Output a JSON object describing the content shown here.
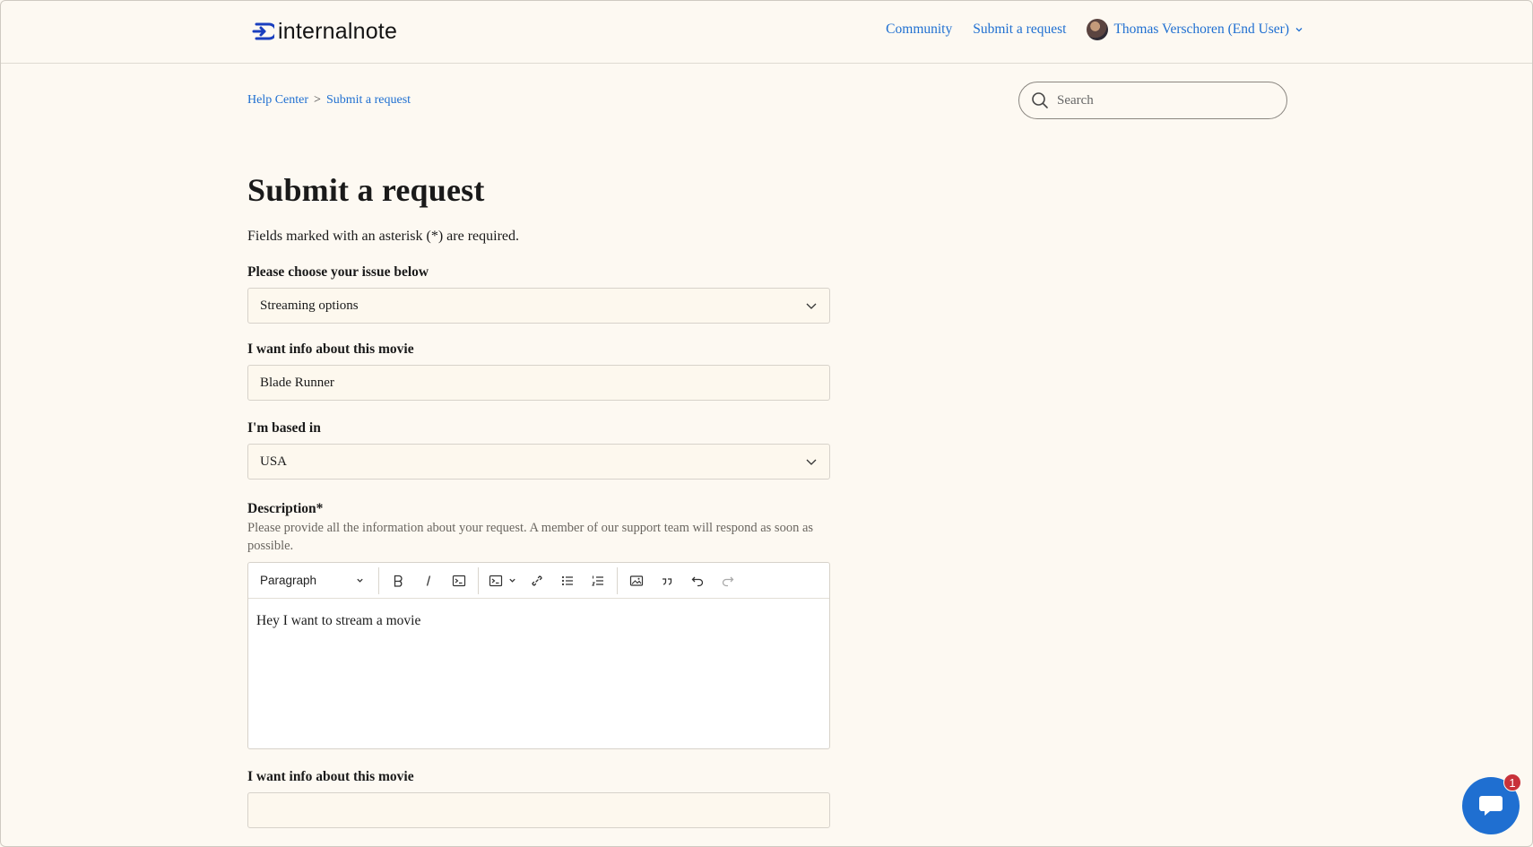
{
  "header": {
    "logo_text": "internalnote",
    "nav": {
      "community": "Community",
      "submit_request": "Submit a request",
      "user_name": "Thomas Verschoren (End User)"
    }
  },
  "breadcrumb": {
    "home": "Help Center",
    "separator": ">",
    "current": "Submit a request"
  },
  "search": {
    "placeholder": "Search"
  },
  "page": {
    "title": "Submit a request",
    "required_note": "Fields marked with an asterisk (*) are required."
  },
  "form": {
    "issue": {
      "label": "Please choose your issue below",
      "value": "Streaming options"
    },
    "movie": {
      "label": "I want info about this movie",
      "value": "Blade Runner"
    },
    "based_in": {
      "label": "I'm based in",
      "value": "USA"
    },
    "description": {
      "label": "Description*",
      "hint": "Please provide all the information about your request. A member of our support team will respond as soon as possible.",
      "format": "Paragraph",
      "body": "Hey I want to stream a movie"
    },
    "movie_second": {
      "label": "I want info about this movie"
    }
  },
  "chat": {
    "badge_count": "1"
  },
  "colors": {
    "background": "#fdf9f2",
    "link": "#1f6fd1",
    "logo_accent": "#1a3fbf",
    "chat_button": "#1f6fd1",
    "badge": "#c8323a"
  },
  "icons": {
    "toolbar": [
      "bold-icon",
      "italic-icon",
      "code-icon",
      "code-block-icon",
      "link-icon",
      "bulleted-list-icon",
      "numbered-list-icon",
      "image-icon",
      "quote-icon",
      "undo-icon",
      "redo-icon"
    ]
  }
}
